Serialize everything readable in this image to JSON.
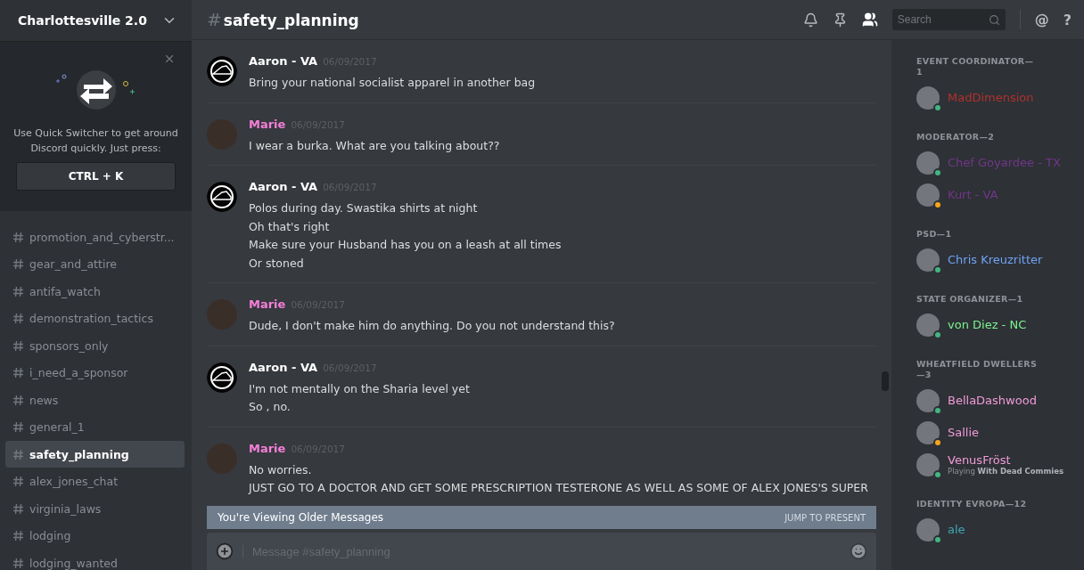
{
  "server": {
    "name": "Charlottesville 2.0"
  },
  "quick_switcher": {
    "text": "Use Quick Switcher to get around Discord quickly. Just press:",
    "shortcut": "CTRL + K"
  },
  "channels": [
    {
      "name": "promotion_and_cyberstr...",
      "selected": false
    },
    {
      "name": "gear_and_attire",
      "selected": false
    },
    {
      "name": "antifa_watch",
      "selected": false
    },
    {
      "name": "demonstration_tactics",
      "selected": false
    },
    {
      "name": "sponsors_only",
      "selected": false
    },
    {
      "name": "i_need_a_sponsor",
      "selected": false
    },
    {
      "name": "news",
      "selected": false
    },
    {
      "name": "general_1",
      "selected": false
    },
    {
      "name": "safety_planning",
      "selected": true
    },
    {
      "name": "alex_jones_chat",
      "selected": false
    },
    {
      "name": "virginia_laws",
      "selected": false
    },
    {
      "name": "lodging",
      "selected": false
    },
    {
      "name": "lodging_wanted",
      "selected": false
    }
  ],
  "header": {
    "hash": "#",
    "channel": "safety_planning",
    "search_placeholder": "Search",
    "mention": "@",
    "help": "?"
  },
  "messages": [
    {
      "author": "Aaron - VA",
      "color": "#ffffff",
      "kind": "logo",
      "time": "06/09/2017",
      "lines": [
        "Bring your national socialist  apparel in another bag"
      ]
    },
    {
      "author": "Marie",
      "color": "#f47fd8",
      "kind": "photo",
      "time": "06/09/2017",
      "lines": [
        "I wear a burka. What are you talking about??"
      ]
    },
    {
      "author": "Aaron - VA",
      "color": "#ffffff",
      "kind": "logo",
      "time": "06/09/2017",
      "lines": [
        "Polos during day. Swastika shirts at night",
        "Oh that's right",
        "Make sure your Husband has you on a leash at all times",
        "Or stoned"
      ]
    },
    {
      "author": "Marie",
      "color": "#f47fd8",
      "kind": "photo",
      "time": "06/09/2017",
      "lines": [
        "Dude, I don't make him do anything. Do you not understand this?"
      ]
    },
    {
      "author": "Aaron - VA",
      "color": "#ffffff",
      "kind": "logo",
      "time": "06/09/2017",
      "lines": [
        "I'm not mentally on the Sharia level yet",
        "So , no."
      ]
    },
    {
      "author": "Marie",
      "color": "#f47fd8",
      "kind": "photo",
      "time": "06/09/2017",
      "lines": [
        "No worries.",
        "JUST GO TO A DOCTOR AND GET SOME PRESCRIPTION TESTERONE AS WELL AS SOME OF ALEX JONES'S SUPER"
      ]
    }
  ],
  "older_banner": {
    "text": "You're Viewing Older Messages",
    "action": "JUMP TO PRESENT"
  },
  "composer": {
    "placeholder": "Message #safety_planning"
  },
  "member_groups": [
    {
      "title": "EVENT COORDINATOR—1",
      "members": [
        {
          "name": "MadDimension",
          "color": "#b0322c",
          "idle": false
        }
      ]
    },
    {
      "title": "MODERATOR—2",
      "members": [
        {
          "name": "Chef Goyardee - TX",
          "color": "#71368a",
          "idle": false
        },
        {
          "name": "Kurt - VA",
          "color": "#71368a",
          "idle": true
        }
      ]
    },
    {
      "title": "PSD—1",
      "members": [
        {
          "name": "Chris Kreuzritter",
          "color": "#6fa3f4",
          "idle": false
        }
      ]
    },
    {
      "title": "STATE ORGANIZER—1",
      "members": [
        {
          "name": "von Diez - NC",
          "color": "#7cf48e",
          "idle": false
        }
      ]
    },
    {
      "title": "WHEATFIELD DWELLERS—3",
      "members": [
        {
          "name": "BellaDashwood",
          "color": "#f19bd8",
          "idle": false
        },
        {
          "name": "Sallie",
          "color": "#f19bd8",
          "idle": true
        },
        {
          "name": "VenusFröst",
          "color": "#f19bd8",
          "idle": false,
          "activity": "Playing **With Dead Commies**"
        }
      ]
    },
    {
      "title": "IDENTITY EVROPA—12",
      "members": [
        {
          "name": "ale",
          "color": "#3fa7b5",
          "idle": false
        }
      ]
    }
  ]
}
